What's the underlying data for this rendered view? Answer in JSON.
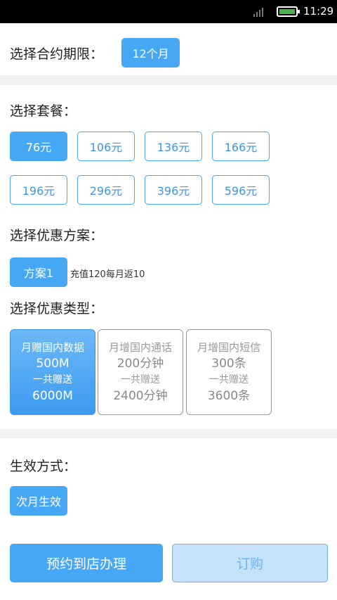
{
  "status_bar": {
    "time": "11:29"
  },
  "contract": {
    "label": "选择合约期限：",
    "options": [
      "12个月"
    ]
  },
  "package": {
    "label": "选择套餐：",
    "options": [
      "76元",
      "106元",
      "136元",
      "166元",
      "196元",
      "296元",
      "396元",
      "596元"
    ],
    "selected": "76元"
  },
  "promo_plan": {
    "label": "选择优惠方案：",
    "option": "方案1",
    "note": "充值120每月返10"
  },
  "promo_type": {
    "label": "选择优惠类型：",
    "cards": [
      {
        "line1": "月赠国内数据",
        "line2": "500M",
        "line3": "一共赠送",
        "line4": "6000M"
      },
      {
        "line1": "月增国内通话",
        "line2": "200分钟",
        "line3": "一共赠送",
        "line4": "2400分钟"
      },
      {
        "line1": "月增国内短信",
        "line2": "300条",
        "line3": "一共赠送",
        "line4": "3600条"
      }
    ],
    "selected_index": 0
  },
  "effective": {
    "label": "生效方式：",
    "option": "次月生效"
  },
  "actions": {
    "reserve_label": "预约到店办理",
    "order_label": "订购"
  },
  "colors": {
    "accent": "#46a8f5",
    "accent_light": "#c6e2fb",
    "divider": "#f2f2f2"
  }
}
